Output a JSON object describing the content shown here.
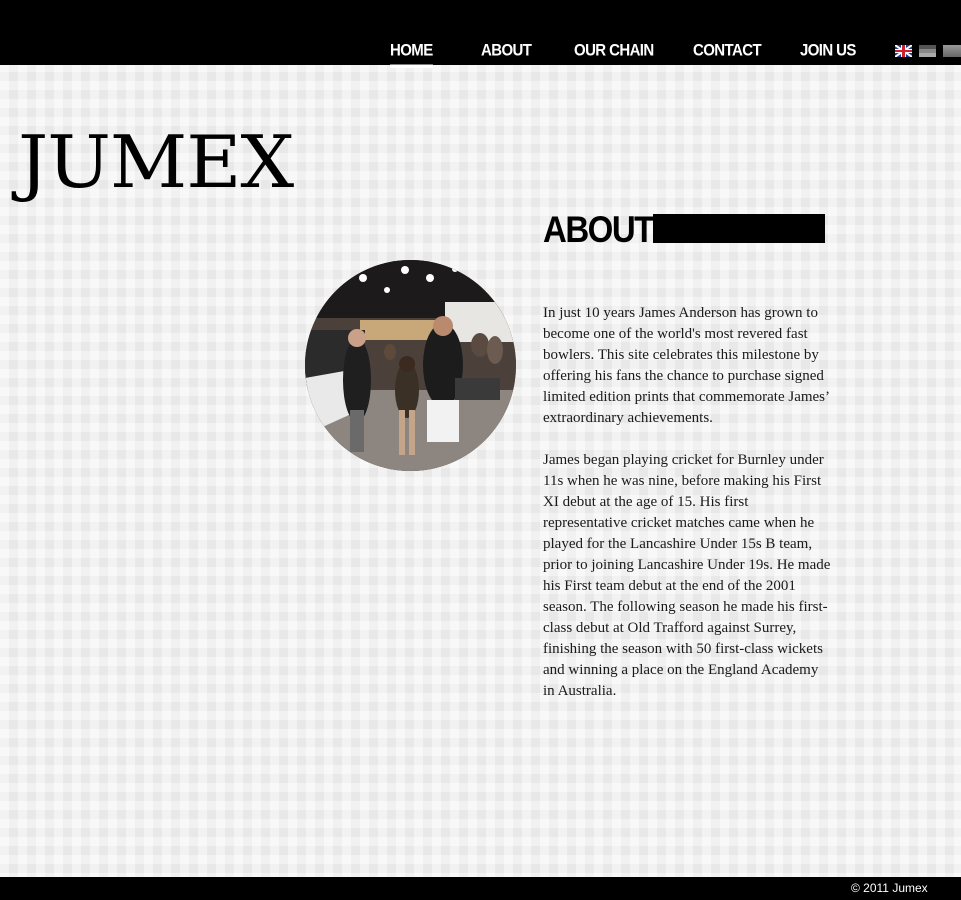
{
  "nav": {
    "items": [
      {
        "label": "HOME",
        "active": true
      },
      {
        "label": "ABOUT",
        "active": false
      },
      {
        "label": "OUR CHAIN",
        "active": false
      },
      {
        "label": "CONTACT",
        "active": false
      },
      {
        "label": "JOIN US",
        "active": false
      }
    ],
    "languages": [
      "uk-flag-icon",
      "german-flag-icon",
      "language-flag-icon"
    ]
  },
  "logo": {
    "text": "JUMEX"
  },
  "about": {
    "heading": "ABOUT",
    "paragraphs": [
      "In just 10 years James Anderson has grown to become one of the world's most revered fast bowlers. This site celebrates this milestone by offering his fans the chance to purchase signed limited edition prints that commemorate James’ extraordinary achievements.",
      "James began playing cricket for Burnley under 11s when he was nine, before making his First XI debut at the age of 15. His first representative cricket matches came when he played for the Lancashire Under 15s B team, prior to joining Lancashire Under 19s. He made his First team debut at the end of the 2001 season. The following season he made his first-class debut at Old Trafford against Surrey, finishing the season with 50 first-class wickets and winning a place on the England Academy in Australia."
    ]
  },
  "footer": {
    "copyright": "© 2011 Jumex"
  },
  "colors": {
    "bar": "#000000",
    "background": "#efefef",
    "text": "#1a1a1a"
  }
}
